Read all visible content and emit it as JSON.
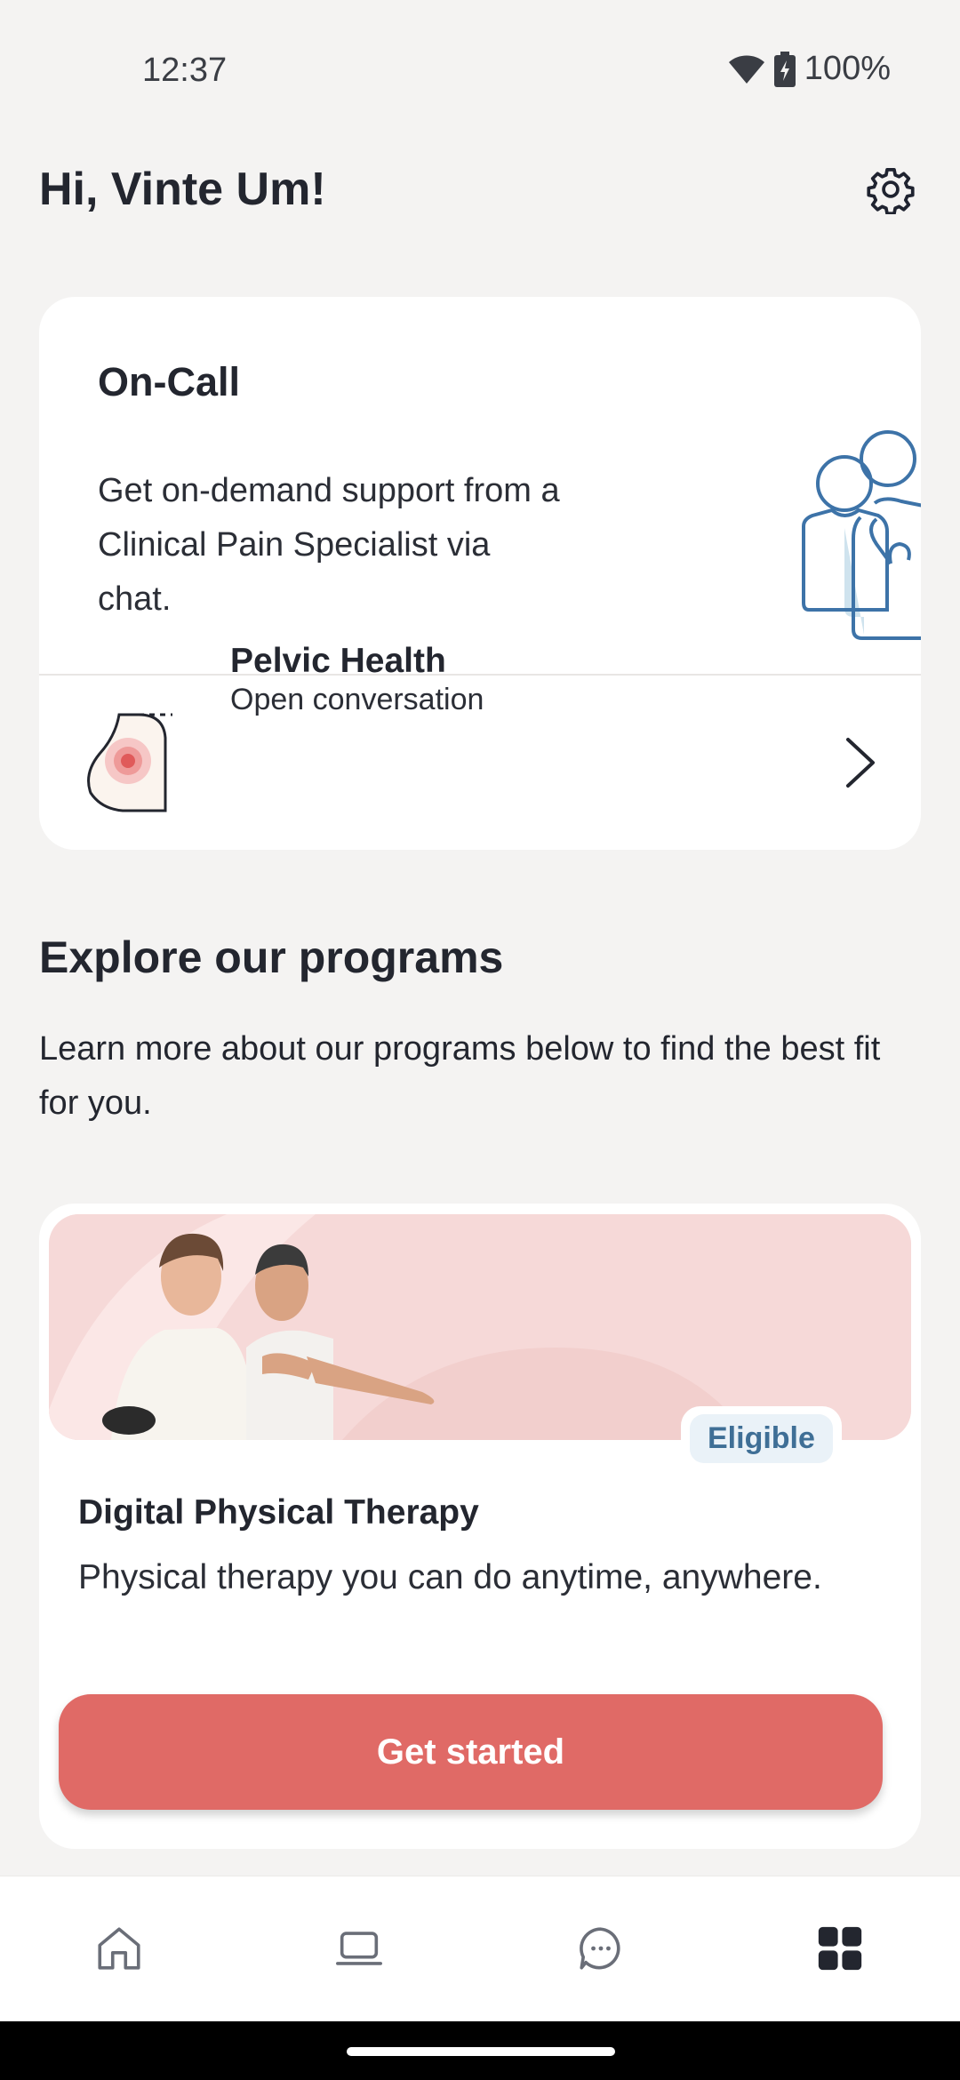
{
  "status_bar": {
    "time": "12:37",
    "battery": "100%"
  },
  "header": {
    "greeting": "Hi, Vinte Um!",
    "settings_icon": "gear-icon"
  },
  "oncall": {
    "title": "On-Call",
    "description": "Get on-demand support from a Clinical Pain Specialist via chat.",
    "conversation": {
      "title": "Pelvic Health",
      "subtitle": "Open conversation"
    }
  },
  "programs": {
    "title": "Explore our programs",
    "description": "Learn more about our programs below to find the best fit for you.",
    "items": [
      {
        "badge": "Eligible",
        "title": "Digital Physical Therapy",
        "description": "Physical therapy you can do anytime, anywhere.",
        "cta": "Get started"
      }
    ]
  },
  "bottom_nav": {
    "items": [
      {
        "icon": "home-icon",
        "active": false
      },
      {
        "icon": "laptop-icon",
        "active": false
      },
      {
        "icon": "chat-icon",
        "active": false
      },
      {
        "icon": "grid-icon",
        "active": true
      }
    ]
  },
  "colors": {
    "accent": "#e06a66",
    "badge_text": "#3f6f96",
    "illustration_stroke": "#3d73a8",
    "background": "#f4f3f2"
  }
}
